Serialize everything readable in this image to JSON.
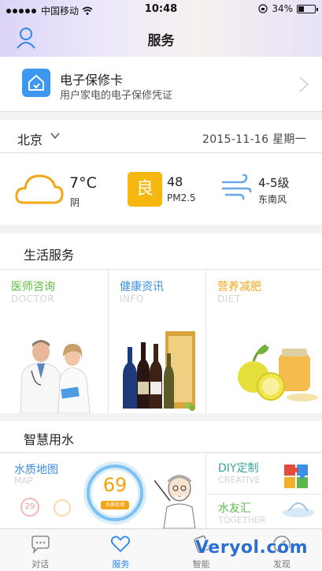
{
  "status": {
    "carrier": "中国移动",
    "time": "10:48",
    "battery": "34%",
    "battery_level": 0.34
  },
  "nav": {
    "title": "服务"
  },
  "warranty": {
    "title": "电子保修卡",
    "subtitle": "用户家电的电子保修凭证"
  },
  "location": {
    "city": "北京",
    "date": "2015-11-16  星期一"
  },
  "weather": {
    "temp": "7°C",
    "condition": "阴",
    "aqi_badge": "良",
    "aqi_value": "48",
    "aqi_label": "PM2.5",
    "wind_level": "4-5级",
    "wind_dir": "东南风"
  },
  "life": {
    "title": "生活服务",
    "items": [
      {
        "cn": "医师咨询",
        "en": "DOCTOR",
        "color": "#5cbd3c"
      },
      {
        "cn": "健康资讯",
        "en": "INFO",
        "color": "#3c8ee6"
      },
      {
        "cn": "营养减肥",
        "en": "DIET",
        "color": "#f0a71d"
      }
    ]
  },
  "water": {
    "title": "智慧用水",
    "map": {
      "cn": "水质地图",
      "en": "MAP"
    },
    "gauge": {
      "value": "69",
      "label": "水质检测"
    },
    "badges": [
      "29",
      ""
    ],
    "diy": {
      "cn": "DIY定制",
      "en": "CREATIVE"
    },
    "friends": {
      "cn": "水友汇",
      "en": "TOGETHER"
    }
  },
  "tabs": [
    {
      "label": "对话",
      "icon": "chat-icon"
    },
    {
      "label": "服务",
      "icon": "heart-icon"
    },
    {
      "label": "智能",
      "icon": "smart-icon"
    },
    {
      "label": "发现",
      "icon": "compass-icon"
    }
  ],
  "watermark": "Veryol.com",
  "colors": {
    "accent": "#2a86e8",
    "aqi": "#f6b810",
    "cloud": "#f2a71b",
    "wind": "#6aa7e8"
  }
}
